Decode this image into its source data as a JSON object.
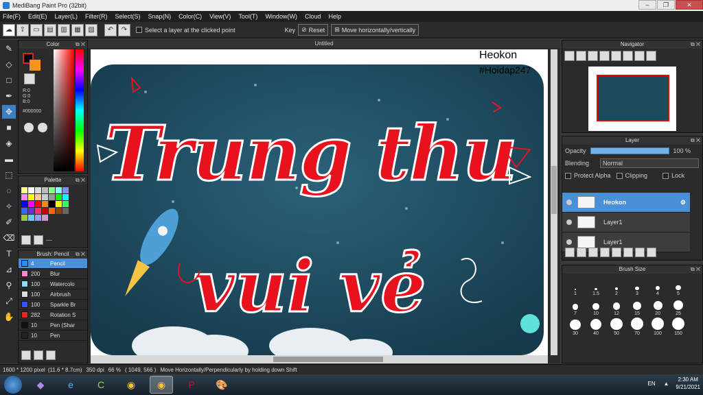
{
  "window": {
    "title": "MediBang Paint Pro (32bit)"
  },
  "menu": [
    "File(F)",
    "Edit(E)",
    "Layer(L)",
    "Filter(R)",
    "Select(S)",
    "Snap(N)",
    "Color(C)",
    "View(V)",
    "Tool(T)",
    "Window(W)",
    "Cloud",
    "Help"
  ],
  "toolbar": {
    "select_layer_label": "Select a layer at the clicked point",
    "key_label": "Key",
    "reset_label": "Reset",
    "move_hv_label": "Move horizontally/vertically"
  },
  "color_panel": {
    "title": "Color",
    "r": "R:0",
    "g": "G:0",
    "b": "B:0",
    "hex": "#000000",
    "foreground": "#000000",
    "background": "#f7931e"
  },
  "palette_panel": {
    "title": "Palette",
    "footer": "---",
    "colors": [
      "#ffff88",
      "#ffffff",
      "#dddddd",
      "#bbbbbb",
      "#88ff88",
      "#88ffff",
      "#8888ff",
      "#ff88ff",
      "#ffff00",
      "#ffcc88",
      "#cccccc",
      "#999999",
      "#00ff00",
      "#00ffff",
      "#0000ff",
      "#ff00ff",
      "#ff0000",
      "#ff8800",
      "#000000",
      "#ffff00",
      "#33ff66",
      "#3366ff",
      "#6633cc",
      "#ff3366",
      "#cc0000",
      "#ff6600",
      "#884400",
      "#666666",
      "#99cc33",
      "#66ccff",
      "#9999ff",
      "#cc99cc"
    ]
  },
  "brush_panel": {
    "title": "Brush: Pencil",
    "items": [
      {
        "size": "4",
        "name": "Pencil",
        "color": "#1e90ff"
      },
      {
        "size": "200",
        "name": "Blur",
        "color": "#ff88cc"
      },
      {
        "size": "100",
        "name": "Watercolo",
        "color": "#88ddff"
      },
      {
        "size": "100",
        "name": "Airbrush",
        "color": "#dddddd"
      },
      {
        "size": "100",
        "name": "Sparkle Br",
        "color": "#3355ff"
      },
      {
        "size": "282",
        "name": "Rotation S",
        "color": "#ee2222"
      },
      {
        "size": "10",
        "name": "Pen (Shar",
        "color": "#111111"
      },
      {
        "size": "10",
        "name": "Pen",
        "color": "#222222"
      }
    ]
  },
  "document": {
    "tab_title": "Untitled",
    "watermark_name": "Heokon",
    "watermark_tag": "#Hoidap247"
  },
  "artwork": {
    "line1": "Trung thu",
    "line2": "vui vẻ",
    "sky_color": "#1e4a5e",
    "text_color": "#e8121f"
  },
  "navigator": {
    "title": "Navigator"
  },
  "layer_panel": {
    "title": "Layer",
    "opacity_label": "Opacity",
    "opacity_value": "100 %",
    "opacity_fraction": 1.0,
    "blending_label": "Blending",
    "blending_value": "Normal",
    "protect_alpha": "Protect Alpha",
    "clipping": "Clipping",
    "lock": "Lock",
    "layers": [
      {
        "name": "Heokon",
        "selected": true
      },
      {
        "name": "Layer1",
        "selected": false
      },
      {
        "name": "Layer1",
        "selected": false
      }
    ]
  },
  "brush_size_panel": {
    "title": "Brush Size",
    "sizes": [
      "1",
      "1.5",
      "2",
      "3",
      "4",
      "5",
      "7",
      "10",
      "12",
      "15",
      "20",
      "25",
      "30",
      "40",
      "50",
      "70",
      "100",
      "150"
    ]
  },
  "status": {
    "canvas_size": "1600 * 1200 pixel",
    "physical_size": "(11.6 * 8.7cm)",
    "dpi": "350 dpi",
    "zoom": "66 %",
    "cursor": "( 1049, 566 )",
    "hint": "Move Horizontally/Perpendicularly by holding down Shift"
  },
  "taskbar": {
    "lang": "EN",
    "time": "2:30 AM",
    "date": "9/21/2021"
  }
}
